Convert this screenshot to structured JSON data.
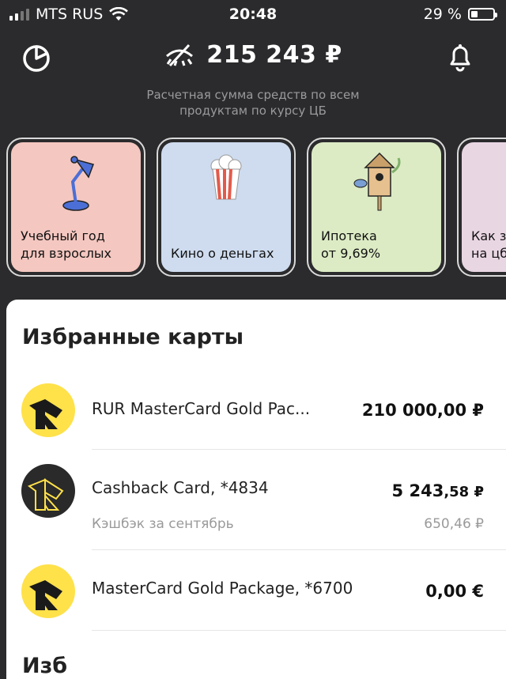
{
  "status_bar": {
    "carrier": "MTS RUS",
    "time": "20:48",
    "battery": "29 %"
  },
  "header": {
    "left_icon": "pie-chart-icon",
    "visibility_icon": "eye-hidden-icon",
    "balance": "215 243 ₽",
    "right_icon": "bell-icon",
    "subtitle_line1": "Расчетная сумма средств по всем",
    "subtitle_line2": "продуктам по курсу ЦБ"
  },
  "stories": [
    {
      "line1": "Учебный год",
      "line2": "для взрослых",
      "bg": "#f4c7c0",
      "icon": "desk-lamp-icon"
    },
    {
      "line1": "",
      "line2": "Кино о деньгах",
      "bg": "#cfdcef",
      "icon": "popcorn-icon"
    },
    {
      "line1": "Ипотека",
      "line2": "от 9,69%",
      "bg": "#dcebc4",
      "icon": "birdhouse-icon"
    },
    {
      "line1": "Как з",
      "line2": "на цб",
      "bg": "#e9d6e3",
      "icon": "story-icon"
    }
  ],
  "favorites": {
    "title": "Избранные карты",
    "cards": [
      {
        "name": "RUR MasterCard Gold Pac...",
        "amount_main": "210 000",
        "amount_frac": ",00 ₽",
        "logo_bg": "#ffe14a"
      },
      {
        "name": "Cashback Card, *4834",
        "amount_main": "5 243",
        "amount_frac": ",58 ₽",
        "logo_bg": "#2a2a2a",
        "sub": "Кэшбэк за сентябрь",
        "sub_amount": "650,46 ₽"
      },
      {
        "name": "MasterCard Gold Package, *6700",
        "amount_main": "0",
        "amount_frac": ",00 €",
        "logo_bg": "#ffe14a"
      }
    ],
    "next_title": "Изб"
  }
}
